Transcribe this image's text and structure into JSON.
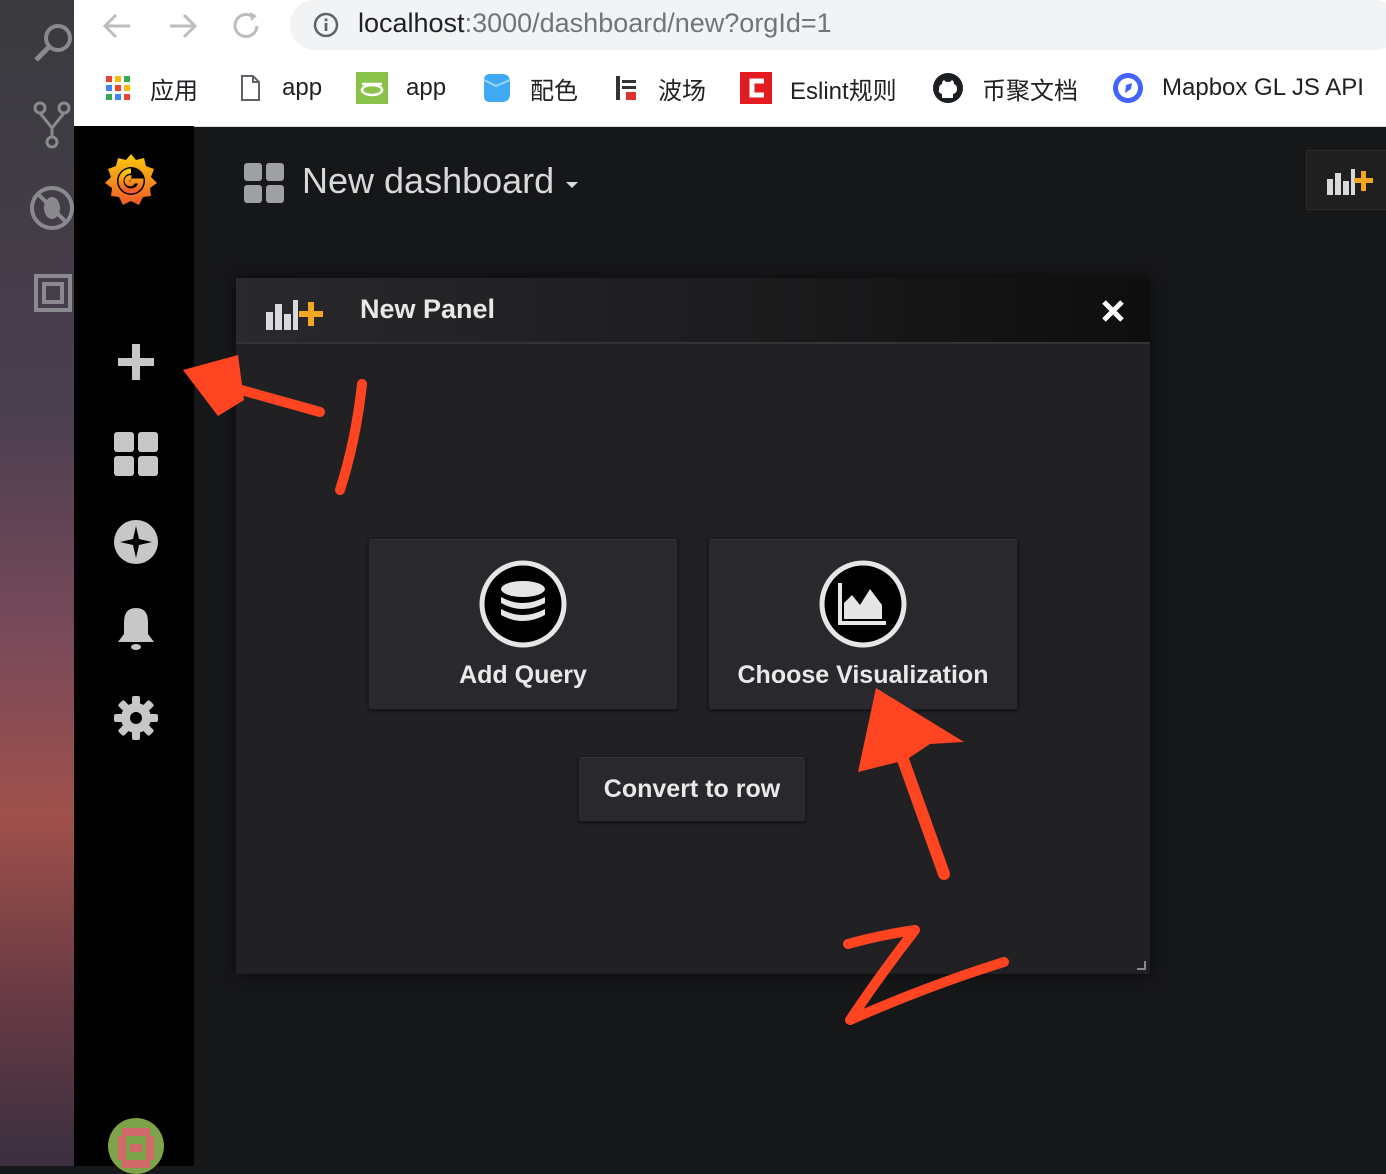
{
  "browser": {
    "url_host": "localhost",
    "url_path": ":3000/dashboard/new?orgId=1",
    "bookmarks": [
      {
        "label": "应用",
        "icon": "apps-grid-icon"
      },
      {
        "label": "app",
        "icon": "page-icon"
      },
      {
        "label": "app",
        "icon": "green-logo-icon"
      },
      {
        "label": "配色",
        "icon": "blue-cube-icon"
      },
      {
        "label": "波场",
        "icon": "tron-icon"
      },
      {
        "label": "Eslint规则",
        "icon": "red-c-icon"
      },
      {
        "label": "币聚文档",
        "icon": "github-icon"
      },
      {
        "label": "Mapbox GL JS API",
        "icon": "mapbox-icon"
      }
    ]
  },
  "dashboard": {
    "title": "New dashboard"
  },
  "panel": {
    "title": "New Panel",
    "add_query_label": "Add Query",
    "choose_viz_label": "Choose Visualization",
    "convert_row_label": "Convert to row"
  },
  "annotations": {
    "mark_1": "1",
    "mark_2": "2",
    "color": "#ff4422"
  },
  "colors": {
    "grafana_orange": "#f5a623",
    "accent": "#eb7b18"
  }
}
